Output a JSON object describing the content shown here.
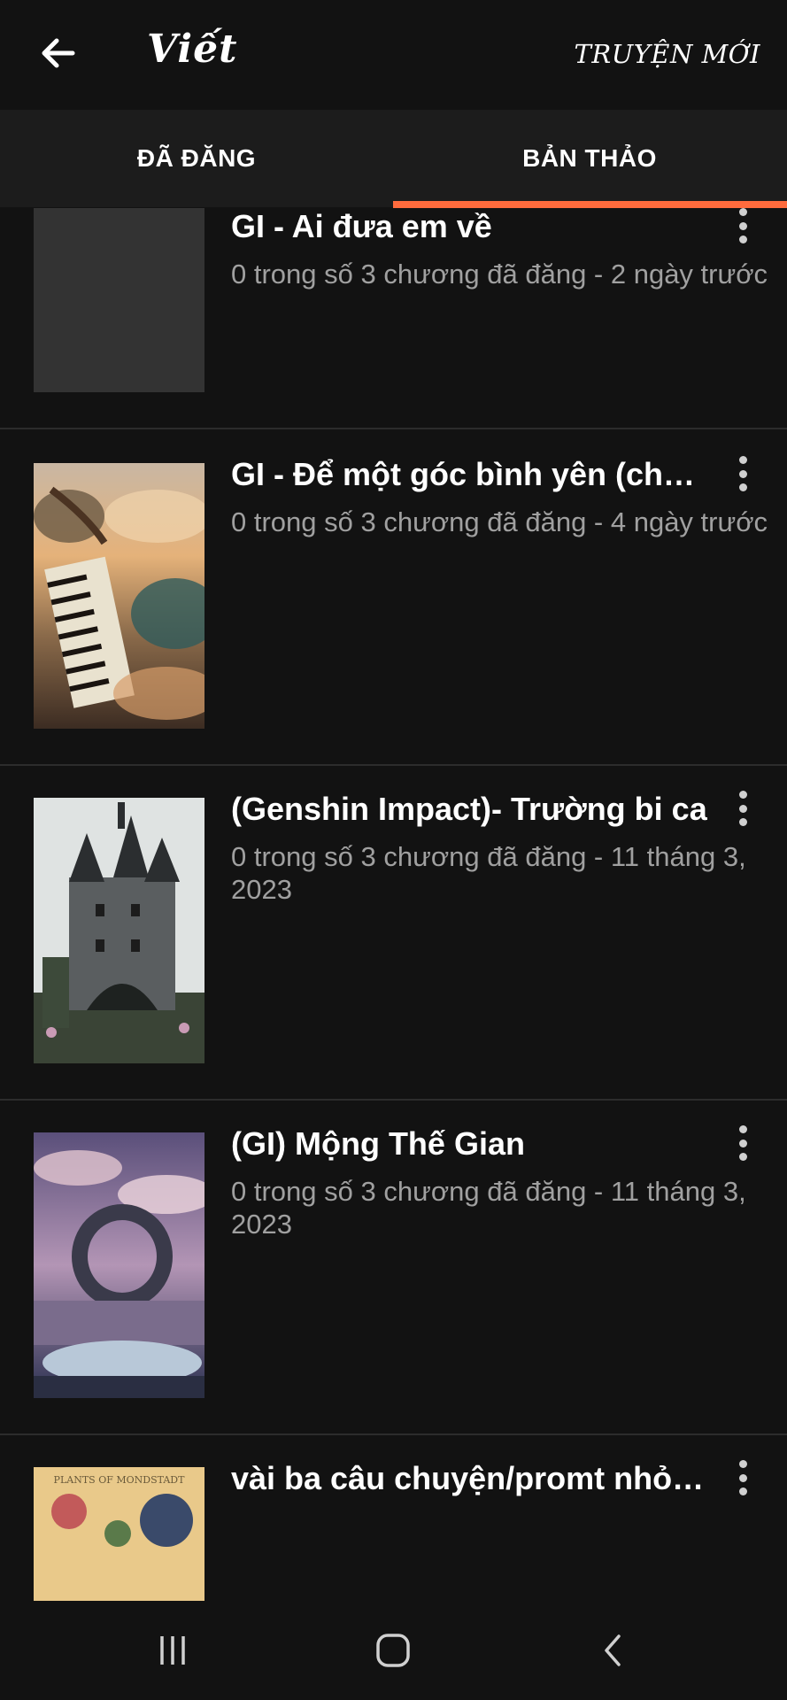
{
  "appbar": {
    "back_icon": "arrow-left-icon",
    "title": "Viết",
    "new_story_label": "TRUYỆN MỚI"
  },
  "tabs": [
    {
      "label": "ĐÃ ĐĂNG",
      "active": false
    },
    {
      "label": "BẢN THẢO",
      "active": true
    }
  ],
  "accent_color": "#ff6b3d",
  "stories": [
    {
      "title": "GI - Ai đưa em về",
      "meta": "0 trong số 3 chương đã đăng - 2 ngày trước",
      "cover": "blank-cover"
    },
    {
      "title": "GI - Để một góc bình yên (cho t...",
      "meta": "0 trong số 3 chương đã đăng - 4 ngày trước",
      "cover": "piano-sky-painting"
    },
    {
      "title": "(Genshin Impact)- Trường bi ca",
      "meta": "0 trong số 3 chương đã đăng - 11 tháng 3, 2023",
      "cover": "dark-castle-painting"
    },
    {
      "title": "(GI) Mộng Thế Gian",
      "meta": "0 trong số 3 chương đã đăng - 11 tháng 3, 2023",
      "cover": "stone-ring-landscape"
    },
    {
      "title": "vài ba câu chuyện/promt nhỏ x...",
      "meta": "",
      "cover": "plants-book-cover",
      "cover_text": "PLANTS OF MONDSTADT"
    }
  ],
  "navbar": {
    "recents_icon": "recent-apps-icon",
    "home_icon": "home-icon",
    "back_icon": "nav-back-icon"
  }
}
